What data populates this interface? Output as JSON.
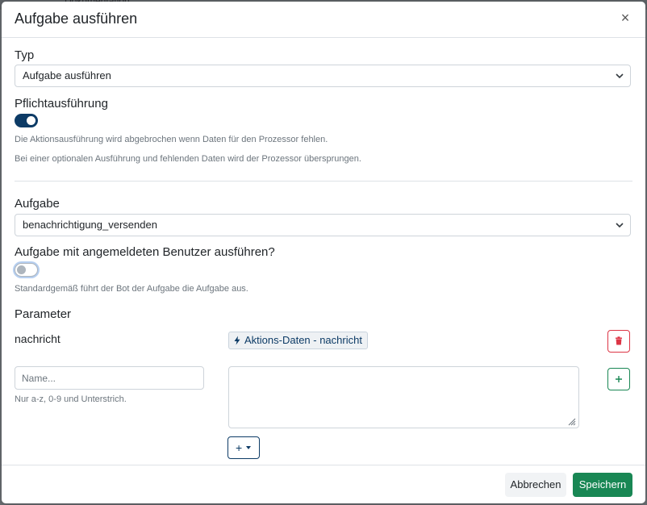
{
  "backdrop": {
    "text": "Dokumentation"
  },
  "modal": {
    "title": "Aufgabe ausführen",
    "close_icon": "×"
  },
  "form": {
    "typ_label": "Typ",
    "typ_value": "Aufgabe ausführen",
    "pflicht_label": "Pflichtausführung",
    "pflicht_on": true,
    "pflicht_help1": "Die Aktionsausführung wird abgebrochen wenn Daten für den Prozessor fehlen.",
    "pflicht_help2": "Bei einer optionalen Ausführung und fehlenden Daten wird der Prozessor übersprungen.",
    "aufgabe_label": "Aufgabe",
    "aufgabe_value": "benachrichtigung_versenden",
    "benutzer_label": "Aufgabe mit angemeldeten Benutzer ausführen?",
    "benutzer_on": false,
    "benutzer_help": "Standardgemäß führt der Bot der Aufgabe die Aufgabe aus.",
    "parameter_label": "Parameter",
    "param_name": "nachricht",
    "param_badge": "Aktions-Daten - nachricht",
    "name_placeholder": "Name...",
    "name_help": "Nur a-z, 0-9 und Unterstrich.",
    "add_button_label": "+"
  },
  "footer": {
    "cancel_label": "Abbrechen",
    "save_label": "Speichern"
  },
  "colors": {
    "primary": "#0d3b66",
    "success": "#198754",
    "danger": "#dc3545"
  },
  "icons": [
    "close-icon",
    "chevron-down-icon",
    "bolt-icon",
    "trash-icon",
    "plus-icon",
    "caret-down-icon",
    "resize-grip-icon"
  ]
}
